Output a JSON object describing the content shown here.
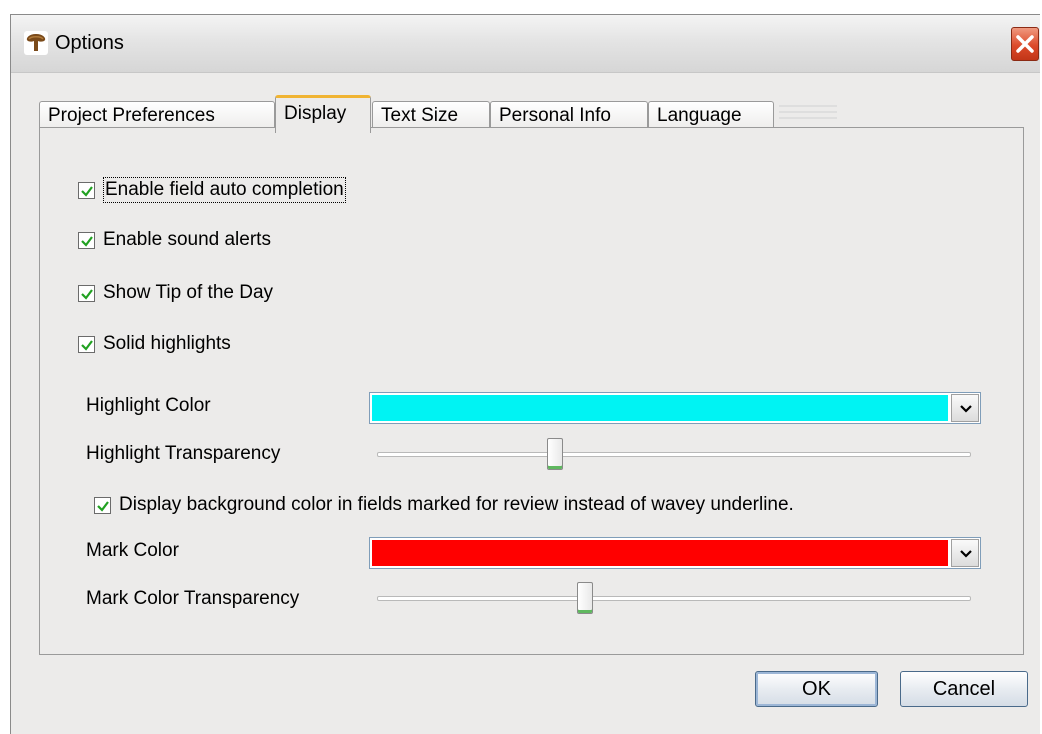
{
  "window": {
    "title": "Options",
    "app_icon": "tree-icon",
    "close_icon": "close-icon"
  },
  "tabs": [
    {
      "label": "Project Preferences",
      "active": false
    },
    {
      "label": "Display",
      "active": true
    },
    {
      "label": "Text Size",
      "active": false
    },
    {
      "label": "Personal Info",
      "active": false
    },
    {
      "label": "Language",
      "active": false
    }
  ],
  "options": [
    {
      "label": "Enable field auto completion",
      "checked": true
    },
    {
      "label": "Enable sound alerts",
      "checked": true
    },
    {
      "label": "Show Tip of the Day",
      "checked": true
    },
    {
      "label": "Solid highlights",
      "checked": true
    }
  ],
  "highlight": {
    "color_label": "Highlight Color",
    "color_value": "#00f3f3",
    "transparency_label": "Highlight Transparency",
    "transparency_fraction": 0.3
  },
  "review": {
    "label": "Display background color in fields marked for review instead of wavey underline.",
    "checked": true
  },
  "mark": {
    "color_label": "Mark Color",
    "color_value": "#ff0000",
    "transparency_label": "Mark Color Transparency",
    "transparency_fraction": 0.35
  },
  "buttons": {
    "ok": "OK",
    "cancel": "Cancel"
  },
  "colors": {
    "dialog_bg": "#ecebea",
    "active_tab_accent": "#f0b433",
    "close_red": "#dc4a2a"
  }
}
